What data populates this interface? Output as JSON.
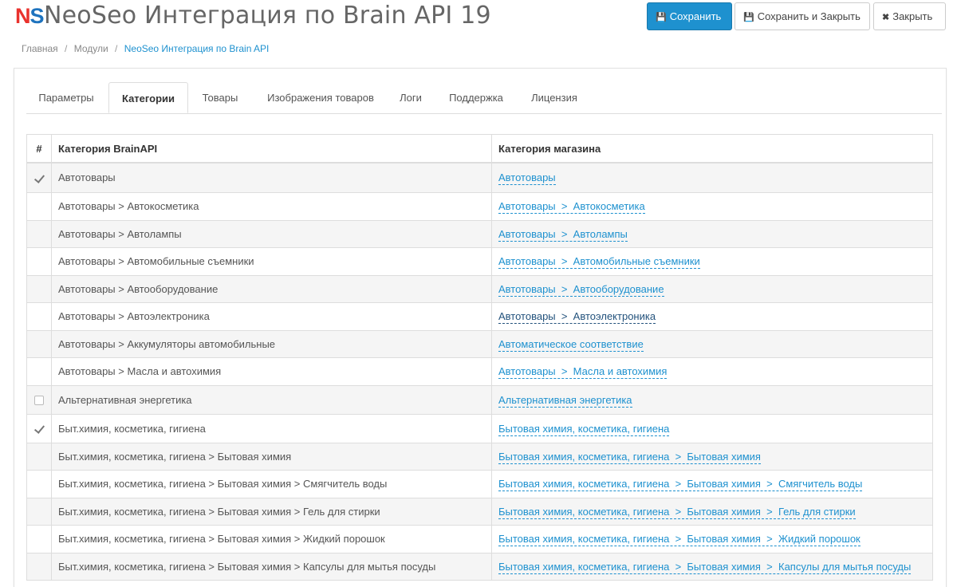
{
  "header": {
    "logo_n": "N",
    "logo_s": "S",
    "title": "NeoSeo Интеграция по Brain API 19",
    "save_label": "Сохранить",
    "save_close_label": "Сохранить и Закрыть",
    "close_label": "Закрыть"
  },
  "breadcrumb": [
    "Главная",
    "Модули",
    "NeoSeo Интеграция по Brain API"
  ],
  "tabs": [
    "Параметры",
    "Категории",
    "Товары",
    "Изображения товаров",
    "Логи",
    "Поддержка",
    "Лицензия"
  ],
  "active_tab": "Категории",
  "table": {
    "headers": [
      "#",
      "Категория BrainAPI",
      "Категория магазина"
    ],
    "rows": [
      {
        "checked": true,
        "checkbox": true,
        "brain": "Автотовары",
        "shop": "Автотовары"
      },
      {
        "checked": false,
        "checkbox": false,
        "brain": "Автотовары > Автокосметика",
        "shop": "Автотовары  >  Автокосметика"
      },
      {
        "checked": false,
        "checkbox": false,
        "brain": "Автотовары > Автолампы",
        "shop": "Автотовары  >  Автолампы"
      },
      {
        "checked": false,
        "checkbox": false,
        "brain": "Автотовары > Автомобильные съемники",
        "shop": "Автотовары  >  Автомобильные съемники"
      },
      {
        "checked": false,
        "checkbox": false,
        "brain": "Автотовары > Автооборудование",
        "shop": "Автотовары  >  Автооборудование"
      },
      {
        "checked": false,
        "checkbox": false,
        "brain": "Автотовары > Автоэлектроника",
        "shop": "Автотовары  >  Автоэлектроника",
        "hover": true
      },
      {
        "checked": false,
        "checkbox": false,
        "brain": "Автотовары > Аккумуляторы автомобильные",
        "shop": "Автоматическое соответствие"
      },
      {
        "checked": false,
        "checkbox": false,
        "brain": "Автотовары > Масла и автохимия",
        "shop": "Автотовары  >  Масла и автохимия"
      },
      {
        "checked": false,
        "checkbox": true,
        "brain": "Альтернативная энергетика",
        "shop": "Альтернативная энергетика"
      },
      {
        "checked": true,
        "checkbox": true,
        "brain": "Быт.химия, косметика, гигиена",
        "shop": "Бытовая химия, косметика, гигиена"
      },
      {
        "checked": false,
        "checkbox": false,
        "brain": "Быт.химия, косметика, гигиена > Бытовая химия",
        "shop": "Бытовая химия, косметика, гигиена  >  Бытовая химия"
      },
      {
        "checked": false,
        "checkbox": false,
        "brain": "Быт.химия, косметика, гигиена > Бытовая химия > Смягчитель воды",
        "shop": "Бытовая химия, косметика, гигиена  >  Бытовая химия  >  Смягчитель воды"
      },
      {
        "checked": false,
        "checkbox": false,
        "brain": "Быт.химия, косметика, гигиена > Бытовая химия > Гель для стирки",
        "shop": "Бытовая химия, косметика, гигиена  >  Бытовая химия  >  Гель для стирки"
      },
      {
        "checked": false,
        "checkbox": false,
        "brain": "Быт.химия, косметика, гигиена > Бытовая химия > Жидкий порошок",
        "shop": "Бытовая химия, косметика, гигиена  >  Бытовая химия  >  Жидкий порошок"
      },
      {
        "checked": false,
        "checkbox": false,
        "brain": "Быт.химия, косметика, гигиена > Бытовая химия > Капсулы для мытья посуды",
        "shop": "Бытовая химия, косметика, гигиена  >  Бытовая химия  >  Капсулы для мытья посуды"
      }
    ]
  },
  "colors": {
    "primary": "#1e91cf",
    "logo_red": "#e9322d",
    "logo_blue": "#1e73be"
  }
}
